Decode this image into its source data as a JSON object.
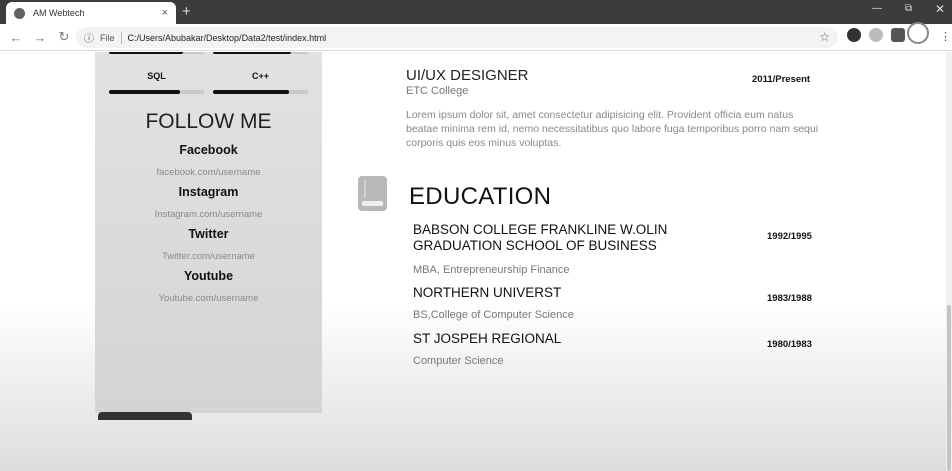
{
  "browser": {
    "tab_title": "AM Webtech",
    "tab_close": "×",
    "new_tab": "+",
    "file_label": "File",
    "url": "C:/Users/Abubakar/Desktop/Data2/test/index.html"
  },
  "sidebar": {
    "skills": [
      {
        "label": "SQL",
        "level": 0.75
      },
      {
        "label": "C++",
        "level": 0.8
      }
    ],
    "follow_title": "FOLLOW ME",
    "socials": [
      {
        "name": "Facebook",
        "url": "facebook.com/username"
      },
      {
        "name": "Instagram",
        "url": "Instagram.com/username"
      },
      {
        "name": "Twitter",
        "url": "Twitter.com/username"
      },
      {
        "name": "Youtube",
        "url": "Youtube.com/username"
      }
    ]
  },
  "experience": {
    "title": "UI/UX DESIGNER",
    "institution": "ETC College",
    "date": "2011/Present",
    "description": "Lorem ipsum dolor sit, amet consectetur adipisicing elit. Provident officia eum natus beatae minima rem id, nemo necessitatibus quo labore fuga temporibus porro nam sequi corporis quis eos minus voluptas."
  },
  "education": {
    "title": "EDUCATION",
    "icon": "book-icon",
    "entries": [
      {
        "school": "BABSON COLLEGE FRANKLINE W.OLIN GRADUATION SCHOOL OF BUSINESS",
        "degree": "MBA, Entrepreneurship Finance",
        "date": "1992/1995"
      },
      {
        "school": "NORTHERN UNIVERST",
        "degree": "BS,College of Computer Science",
        "date": "1983/1988"
      },
      {
        "school": "ST JOSPEH REGIONAL",
        "degree": "Computer Science",
        "date": "1980/1983"
      }
    ]
  }
}
